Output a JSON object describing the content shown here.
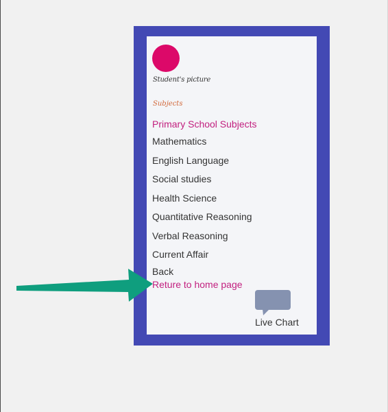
{
  "profile": {
    "caption": "Student's picture"
  },
  "menu": {
    "section_label": "Subjects",
    "heading": "Primary School Subjects",
    "subjects": [
      "Mathematics",
      "English Language",
      "Social studies",
      "Health Science",
      "Quantitative Reasoning",
      "Verbal Reasoning",
      "Current Affair"
    ],
    "back_label": "Back",
    "home_label": "Reture to home page"
  },
  "chat": {
    "label": "Live Chart"
  },
  "colors": {
    "frame": "#4349b4",
    "avatar": "#dc0969",
    "heading": "#c2207f",
    "section_label": "#d2683a",
    "arrow": "#0f9e7e",
    "chat_icon": "#8592b0"
  }
}
